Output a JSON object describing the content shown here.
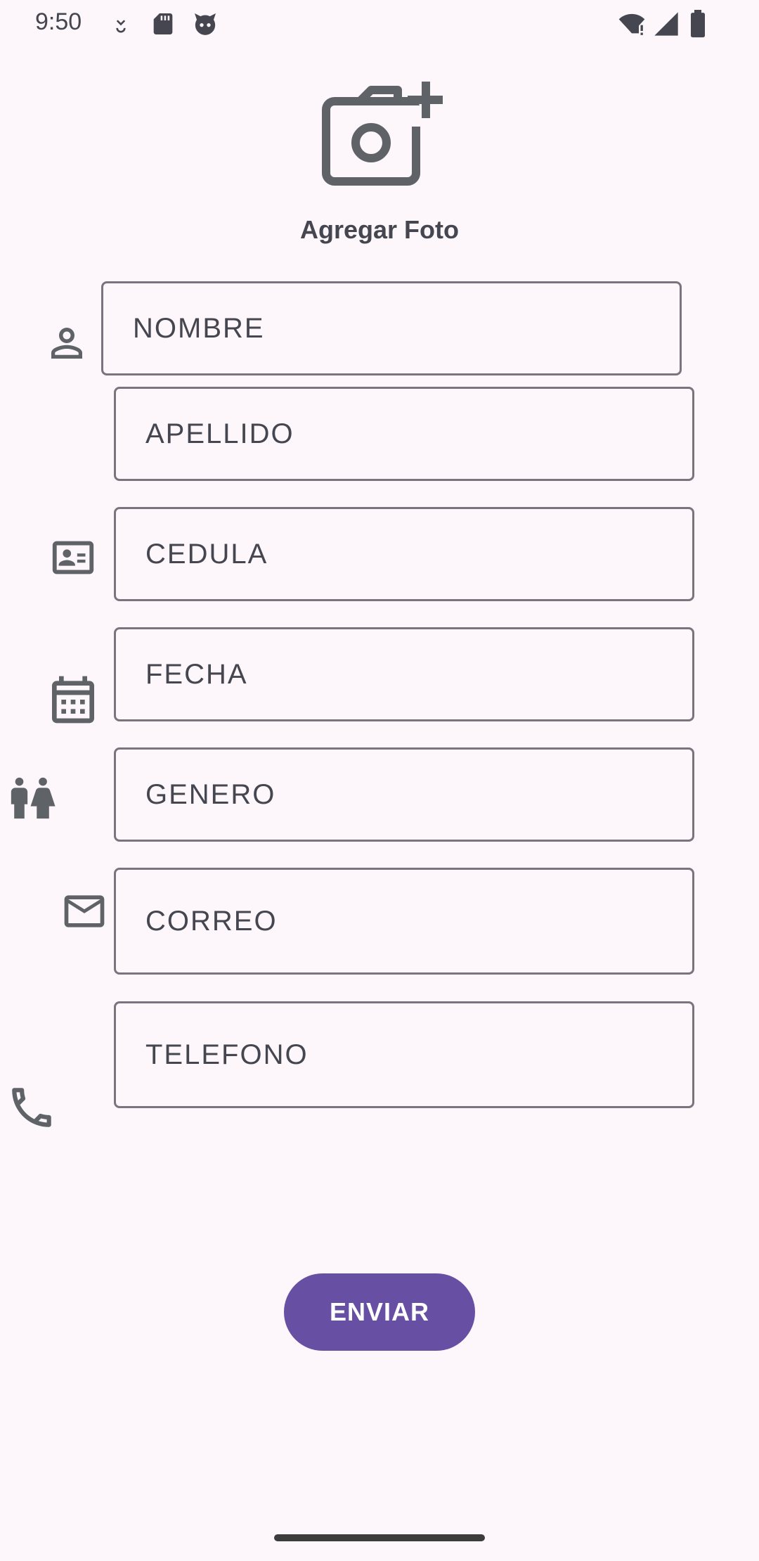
{
  "status_bar": {
    "time": "9:50",
    "left_icons": [
      "download-icon",
      "sd-card-icon",
      "face-icon"
    ],
    "right_icons": [
      "wifi-icon",
      "signal-icon",
      "battery-icon"
    ]
  },
  "photo": {
    "icon": "camera-add-icon",
    "label": "Agregar Foto"
  },
  "form": {
    "fields": [
      {
        "key": "nombre",
        "label": "NOMBRE",
        "icon": "person-icon"
      },
      {
        "key": "apellido",
        "label": "APELLIDO",
        "icon": ""
      },
      {
        "key": "cedula",
        "label": "CEDULA",
        "icon": "id-card-icon"
      },
      {
        "key": "fecha",
        "label": "FECHA",
        "icon": "calendar-icon"
      },
      {
        "key": "genero",
        "label": "GENERO",
        "icon": "gender-icon"
      },
      {
        "key": "correo",
        "label": "CORREO",
        "icon": "mail-icon"
      },
      {
        "key": "telefono",
        "label": "TELEFONO",
        "icon": "phone-icon"
      }
    ],
    "submit_label": "ENVIAR"
  },
  "colors": {
    "background": "#fdf7fc",
    "accent": "#6750a4",
    "icon": "#5f6368",
    "border": "#79747e"
  }
}
